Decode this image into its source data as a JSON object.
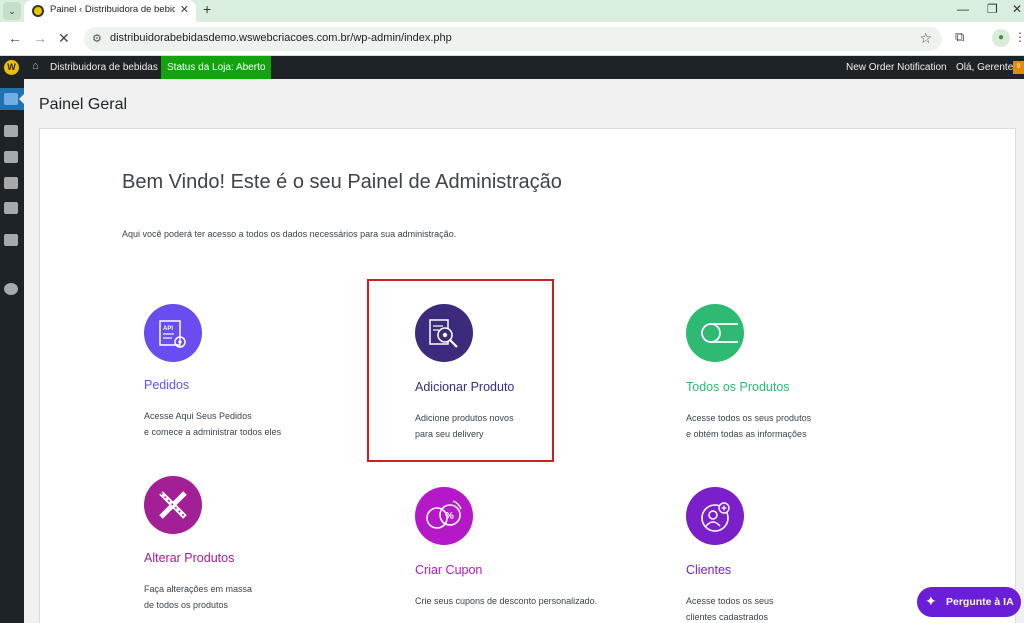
{
  "browser": {
    "tab_title": "Painel ‹ Distribuidora de bebidas",
    "url": "distribuidorabebidasdemo.wswebcriacoes.com.br/wp-admin/index.php"
  },
  "adminbar": {
    "site_name": "Distribuidora de bebidas",
    "store_status": "Status da Loja: Aberto",
    "notification": "New Order Notification",
    "greeting": "Olá, Gerente",
    "avatar_badge": "9"
  },
  "page": {
    "title": "Painel Geral",
    "welcome": "Bem Vindo! Este é o seu Painel de Administração",
    "intro": "Aqui você poderá ter acesso a todos os dados necessários para sua administração."
  },
  "items": [
    {
      "title": "Pedidos",
      "desc": [
        "Acesse Aqui Seus Pedidos",
        "e comece a administrar todos eles"
      ],
      "color": "#6a4cf0",
      "icon": "api-document-gear-icon"
    },
    {
      "title": "Adicionar Produto",
      "desc": [
        "Adicione produtos novos",
        "para seu delivery"
      ],
      "color": "#3d2a7c",
      "icon": "document-magnifier-icon"
    },
    {
      "title": "Todos os Produtos",
      "desc": [
        "Acesse todos os seus produtos",
        "e obtém todas as informações"
      ],
      "color": "#2eba72",
      "icon": "toggle-icon"
    },
    {
      "title": "Alterar Produtos",
      "desc": [
        "Faça alterações em massa",
        "de todos os produtos"
      ],
      "color": "#a21f96",
      "icon": "pencil-ruler-icon"
    },
    {
      "title": "Criar Cupon",
      "desc": [
        "Crie seus cupons de desconto personalizado."
      ],
      "color": "#b418c8",
      "icon": "percent-coupon-icon"
    },
    {
      "title": "Clientes",
      "desc": [
        "Acesse todos os seus",
        "clientes cadastrados"
      ],
      "color": "#7a1fc9",
      "icon": "customer-add-icon"
    }
  ],
  "ai_button": {
    "label": "Pergunte à IA"
  }
}
